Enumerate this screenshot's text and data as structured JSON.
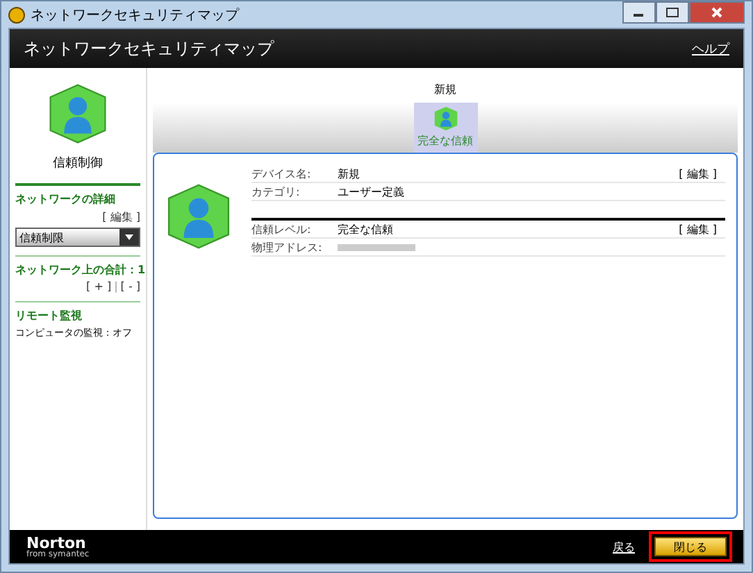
{
  "window": {
    "title": "ネットワークセキュリティマップ"
  },
  "header": {
    "title": "ネットワークセキュリティマップ",
    "help_link": "ヘルプ"
  },
  "sidebar": {
    "device_label": "信頼制御",
    "network_details": {
      "title": "ネットワークの詳細",
      "edit_link": "[ 編集 ]",
      "dropdown_value": "信頼制限"
    },
    "total": {
      "label": "ネットワーク上の合計：1",
      "add_link": "[ + ]",
      "separator": "|",
      "remove_link": "[ - ]"
    },
    "remote": {
      "title": "リモート監視",
      "status": "コンピュータの監視：オフ"
    }
  },
  "map": {
    "group_label": "新規",
    "nodes": [
      {
        "label": "完全な信頼",
        "selected": true
      }
    ]
  },
  "details": {
    "sections": [
      {
        "rows": [
          {
            "label": "デバイス名:",
            "value": "新規",
            "link": "[ 編集 ]"
          },
          {
            "label": "カテゴリ:",
            "value": "ユーザー定義"
          }
        ]
      },
      {
        "rows": [
          {
            "label": "信頼レベル:",
            "value": "完全な信頼",
            "link": "[ 編集 ]"
          },
          {
            "label": "物理アドレス:",
            "redacted": true
          }
        ]
      }
    ]
  },
  "footer": {
    "brand": "Norton",
    "brand_sub": "from symantec",
    "back_link": "戻る",
    "close_button": "閉じる"
  }
}
